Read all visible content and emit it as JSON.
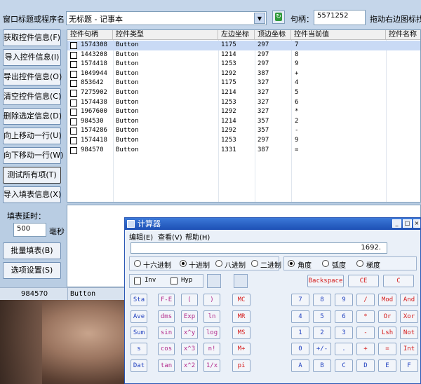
{
  "top": {
    "title_label": "窗口标题或程序名：",
    "title_value": "无标题 - 记事本",
    "handle_label": "句柄：",
    "handle_value": "5571252",
    "drag_hint": "拖动右边图标找控"
  },
  "sidebar": {
    "buttons": [
      "获取控件信息(F)",
      "导入控件信息(I)",
      "导出控件信息(O)",
      "清空控件信息(C)",
      "删除选定信息(D)",
      "向上移动一行(U)",
      "向下移动一行(W)",
      "测试所有项(T)",
      "导入填表信息(X)"
    ],
    "delay_label": "填表延时：",
    "delay_value": "500",
    "delay_unit": "毫秒",
    "batch_button": "批量填表(B)",
    "options_button": "选项设置(S)"
  },
  "table": {
    "columns": [
      "控件句柄",
      "控件类型",
      "左边坐标",
      "顶边坐标",
      "控件当前值",
      "控件名称"
    ],
    "rows": [
      [
        "1574308",
        "Button",
        "1175",
        "297",
        "7"
      ],
      [
        "1443208",
        "Button",
        "1214",
        "297",
        "8"
      ],
      [
        "1574418",
        "Button",
        "1253",
        "297",
        "9"
      ],
      [
        "1049944",
        "Button",
        "1292",
        "387",
        "+"
      ],
      [
        "853642",
        "Button",
        "1175",
        "327",
        "4"
      ],
      [
        "7275902",
        "Button",
        "1214",
        "327",
        "5"
      ],
      [
        "1574438",
        "Button",
        "1253",
        "327",
        "6"
      ],
      [
        "1967600",
        "Button",
        "1292",
        "327",
        "*"
      ],
      [
        "984530",
        "Button",
        "1214",
        "357",
        "2"
      ],
      [
        "1574286",
        "Button",
        "1292",
        "357",
        "-"
      ],
      [
        "1574418",
        "Button",
        "1253",
        "297",
        "9"
      ],
      [
        "984570",
        "Button",
        "1331",
        "387",
        "="
      ]
    ]
  },
  "status": {
    "handle": "984570",
    "type": "Button"
  },
  "calc": {
    "title": "计算器",
    "menu": [
      "编辑(E)",
      "查看(V)",
      "帮助(H)"
    ],
    "display": "1692.",
    "bases": [
      "十六进制",
      "十进制",
      "八进制",
      "二进制"
    ],
    "angles": [
      "角度",
      "弧度",
      "梯度"
    ],
    "inv": "Inv",
    "hyp": "Hyp",
    "backspace": "Backspace",
    "ce": "CE",
    "c": "C",
    "sci": [
      [
        "Sta",
        "F-E",
        "(",
        ")"
      ],
      [
        "Ave",
        "dms",
        "Exp",
        "ln"
      ],
      [
        "Sum",
        "sin",
        "x^y",
        "log"
      ],
      [
        "s",
        "cos",
        "x^3",
        "n!"
      ],
      [
        "Dat",
        "tan",
        "x^2",
        "1/x"
      ]
    ],
    "mem": [
      "MC",
      "MR",
      "MS",
      "M+",
      "pi"
    ],
    "pad": [
      [
        "7",
        "8",
        "9",
        "/",
        "Mod",
        "And"
      ],
      [
        "4",
        "5",
        "6",
        "*",
        "Or",
        "Xor"
      ],
      [
        "1",
        "2",
        "3",
        "-",
        "Lsh",
        "Not"
      ],
      [
        "0",
        "+/-",
        ".",
        "+",
        "=",
        "Int"
      ],
      [
        "A",
        "B",
        "C",
        "D",
        "E",
        "F"
      ]
    ]
  },
  "colors": {
    "title_blue": "#1d50b5",
    "blue_key": "#2343c0",
    "red_key": "#d41919",
    "selection": "#c9daf5"
  }
}
